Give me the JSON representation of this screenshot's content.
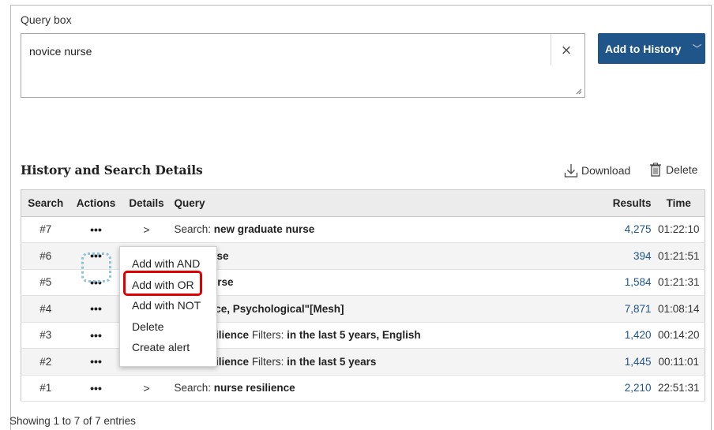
{
  "query_box": {
    "label": "Query box",
    "value": "novice nurse",
    "clear_symbol": "×",
    "add_button_label": "Add to History",
    "add_button_chevron": "﹀"
  },
  "history": {
    "title": "History and Search Details",
    "download_label": "Download",
    "delete_label": "Delete",
    "columns": [
      "Search",
      "Actions",
      "Details",
      "Query",
      "Results",
      "Time"
    ],
    "rows": [
      {
        "num": "#7",
        "actions": "•••",
        "details": ">",
        "prefix": "Search: ",
        "term": "new graduate nurse",
        "filter_label": "",
        "filter_value": "",
        "results": "4,275",
        "time": "01:22:10"
      },
      {
        "num": "#6",
        "actions": "•••",
        "details": "",
        "prefix": "",
        "term": "resh nurse",
        "filter_label": "",
        "filter_value": "",
        "results": "394",
        "time": "01:21:51"
      },
      {
        "num": "#5",
        "actions": "•••",
        "details": "",
        "prefix": "",
        "term": "ovice nurse",
        "filter_label": "",
        "filter_value": "",
        "results": "1,584",
        "time": "01:21:31"
      },
      {
        "num": "#4",
        "actions": "•••",
        "details": "",
        "prefix": "",
        "term": "Resilience, Psychological\"[Mesh]",
        "filter_label": "",
        "filter_value": "",
        "results": "7,871",
        "time": "01:08:14"
      },
      {
        "num": "#3",
        "actions": "•••",
        "details": "",
        "prefix": "",
        "term": "urse resilience",
        "filter_label": " Filters: ",
        "filter_value": "in the last 5 years, English",
        "results": "1,420",
        "time": "00:14:20"
      },
      {
        "num": "#2",
        "actions": "•••",
        "details": "",
        "prefix": "",
        "term": "urse resilience",
        "filter_label": " Filters: ",
        "filter_value": "in the last 5 years",
        "results": "1,445",
        "time": "00:11:01"
      },
      {
        "num": "#1",
        "actions": "•••",
        "details": ">",
        "prefix": "Search: ",
        "term": "nurse resilience",
        "filter_label": "",
        "filter_value": "",
        "results": "2,210",
        "time": "22:51:31"
      }
    ],
    "footer": "Showing 1 to 7 of 7 entries"
  },
  "context_menu": {
    "items": [
      "Add with AND",
      "Add with OR",
      "Add with NOT",
      "Delete",
      "Create alert"
    ],
    "highlighted": "Add with OR"
  },
  "colors": {
    "accent_blue": "#20558a",
    "highlight_red": "#e00000",
    "focus_ring": "#8fc4d8"
  }
}
